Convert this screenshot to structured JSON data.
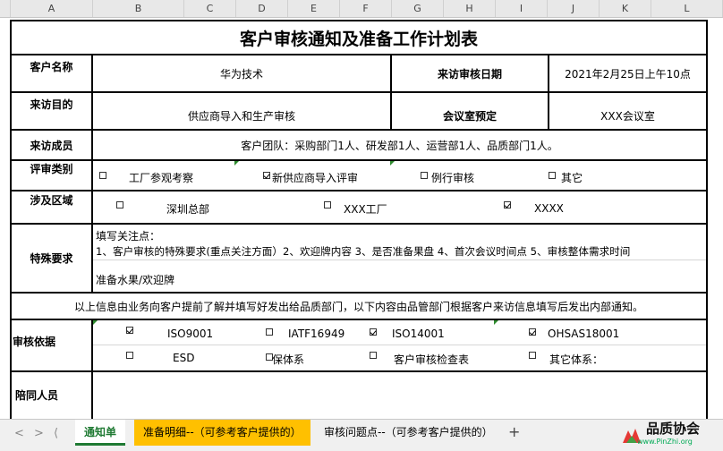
{
  "columns": [
    "A",
    "B",
    "C",
    "D",
    "E",
    "F",
    "G",
    "H",
    "I",
    "J",
    "K",
    "L"
  ],
  "title": "客户审核通知及准备工作计划表",
  "row_customer": {
    "label": "客户名称",
    "value": "华为技术",
    "date_label": "来访审核日期",
    "date_value": "2021年2月25日上午10点"
  },
  "row_purpose": {
    "label": "来访目的",
    "value": "供应商导入和生产审核",
    "room_label": "会议室预定",
    "room_value": "XXX会议室"
  },
  "row_members": {
    "label": "来访成员",
    "value": "客户团队：采购部门1人、研发部1人、运营部1人、品质部门1人。"
  },
  "row_review_type": {
    "label": "评审类别",
    "options": [
      {
        "label": "工厂参观考察",
        "checked": false
      },
      {
        "label": "新供应商导入评审",
        "checked": true
      },
      {
        "label": "例行审核",
        "checked": false
      },
      {
        "label": "其它",
        "checked": false
      }
    ]
  },
  "row_area": {
    "label": "涉及区域",
    "options": [
      {
        "label": "深圳总部",
        "checked": false
      },
      {
        "label": "XXX工厂",
        "checked": false
      },
      {
        "label": "XXXX",
        "checked": true
      }
    ]
  },
  "row_special": {
    "label": "特殊要求",
    "line1": "填写关注点：",
    "line2": "1、客户审核的特殊要求(重点关注方面）2、欢迎牌内容 3、是否准备果盘 4、首次会议时间点  5、审核整体需求时间",
    "line3": "准备水果/欢迎牌"
  },
  "notice": "以上信息由业务向客户提前了解并填写好发出给品质部门，以下内容由品管部门根据客户来访信息填写后发出内部通知。",
  "row_basis": {
    "label": "审核依据",
    "options_row1": [
      {
        "label": "ISO9001",
        "checked": true
      },
      {
        "label": "IATF16949",
        "checked": false
      },
      {
        "label": "ISO14001",
        "checked": true
      },
      {
        "label": "OHSAS18001",
        "checked": true
      }
    ],
    "options_row2": [
      {
        "label": "ESD",
        "checked": false
      },
      {
        "label": "保体系",
        "checked": false
      },
      {
        "label": "客户审核检查表",
        "checked": false
      },
      {
        "label": "其它体系：",
        "checked": false
      }
    ]
  },
  "row_escort": {
    "label": "陪同人员"
  },
  "tabs": {
    "nav": [
      "<",
      ">",
      "⟨",
      ">|"
    ],
    "items": [
      {
        "label": "通知单"
      },
      {
        "label": "准备明细--（可参考客户提供的）"
      },
      {
        "label": "审核问题点--（可参考客户提供的）"
      }
    ],
    "add": "+"
  },
  "watermark": {
    "name": "品质协会",
    "url": "www.PinZhi.org"
  }
}
